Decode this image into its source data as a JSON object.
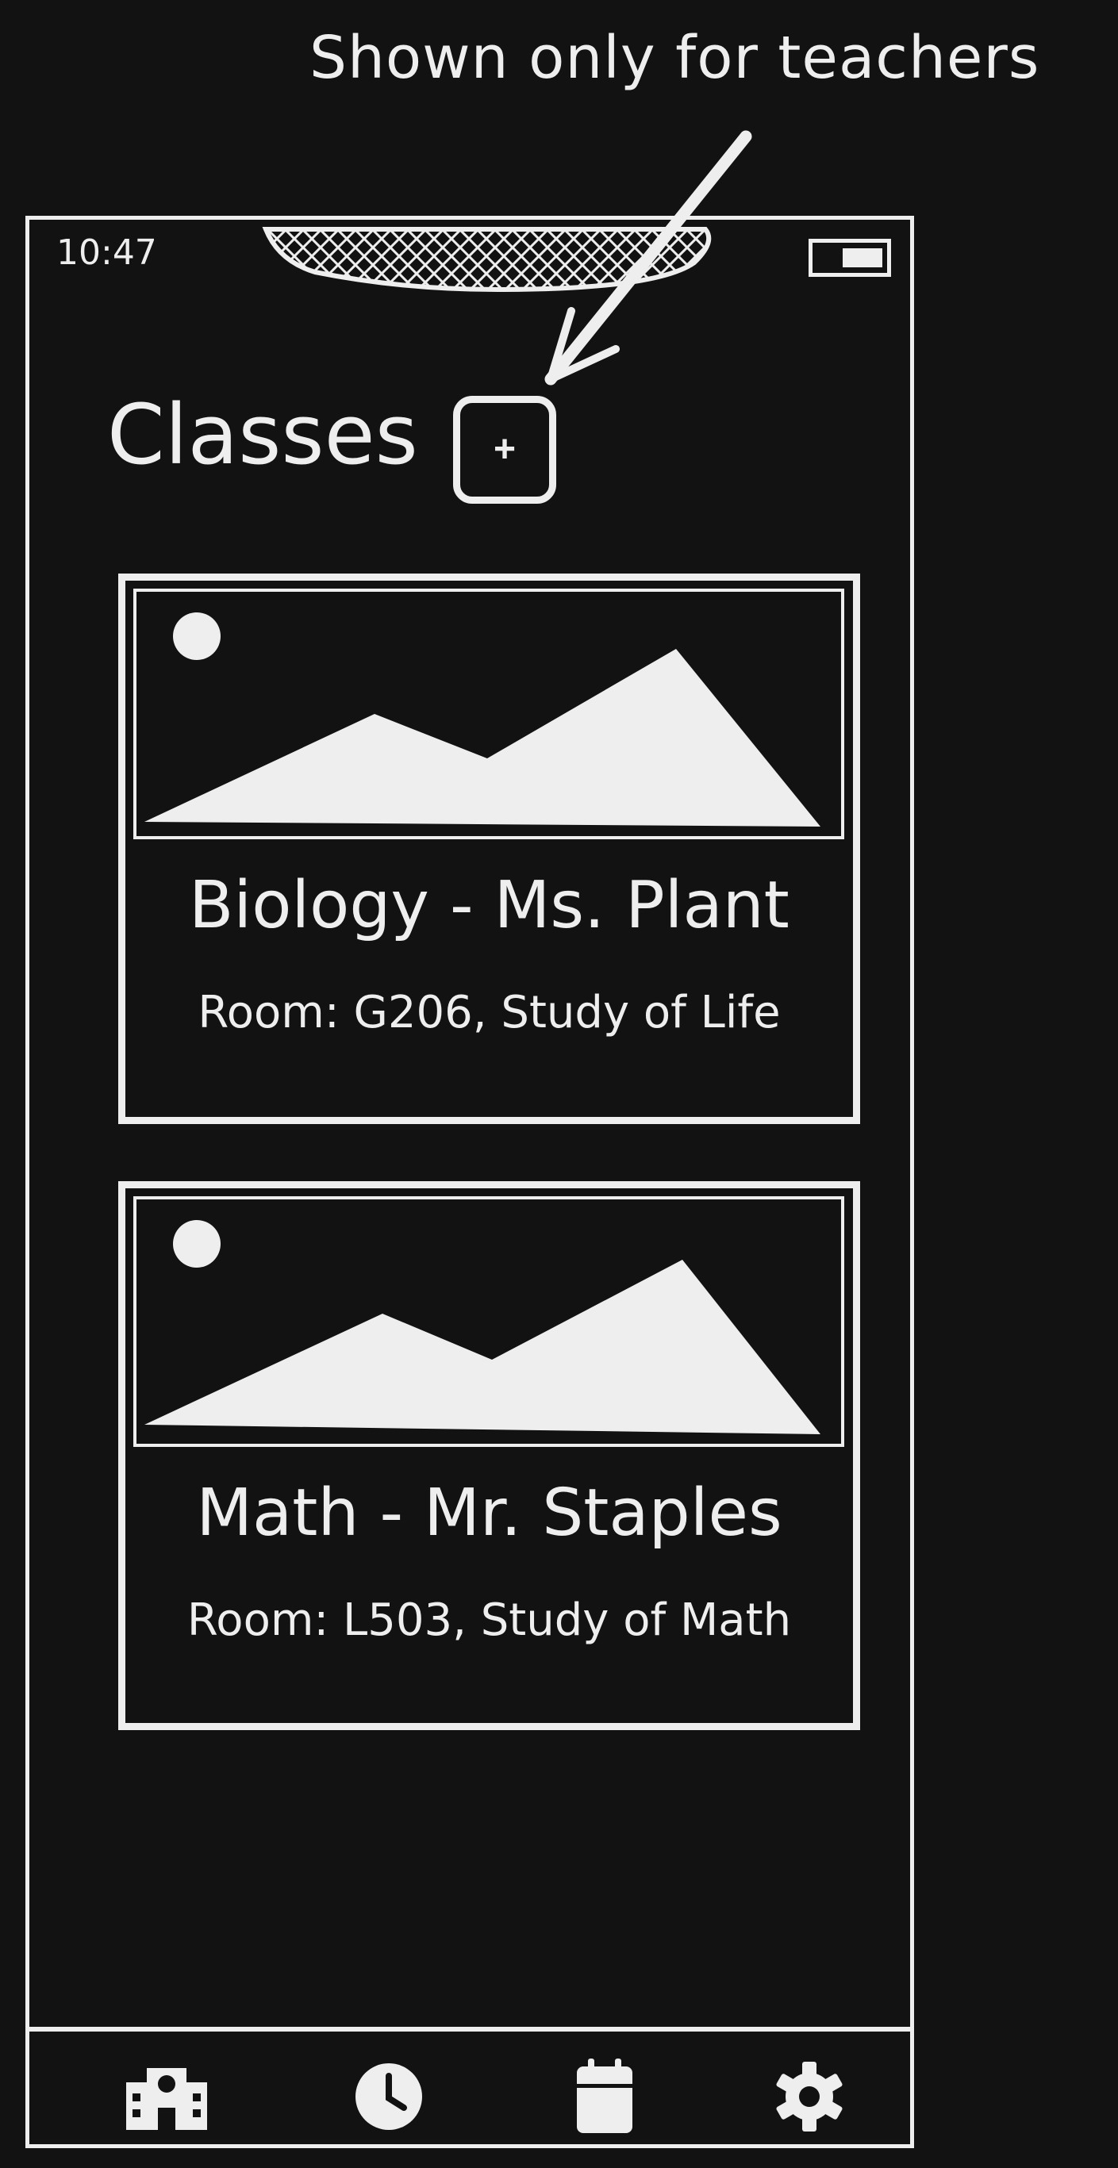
{
  "annotation": {
    "text": "Shown only for teachers"
  },
  "status_bar": {
    "time": "10:47"
  },
  "header": {
    "title": "Classes",
    "add_button_label": "+"
  },
  "classes": [
    {
      "title": "Biology - Ms. Plant",
      "details": "Room: G206, Study of Life",
      "image_icon": "image-placeholder-icon"
    },
    {
      "title": "Math - Mr. Staples",
      "details": "Room: L503, Study of Math",
      "image_icon": "image-placeholder-icon"
    }
  ],
  "bottom_nav": {
    "items": [
      {
        "icon": "school-icon"
      },
      {
        "icon": "clock-icon"
      },
      {
        "icon": "calendar-icon"
      },
      {
        "icon": "gear-icon"
      }
    ]
  },
  "colors": {
    "background": "#121212",
    "foreground": "#eeeeee"
  }
}
